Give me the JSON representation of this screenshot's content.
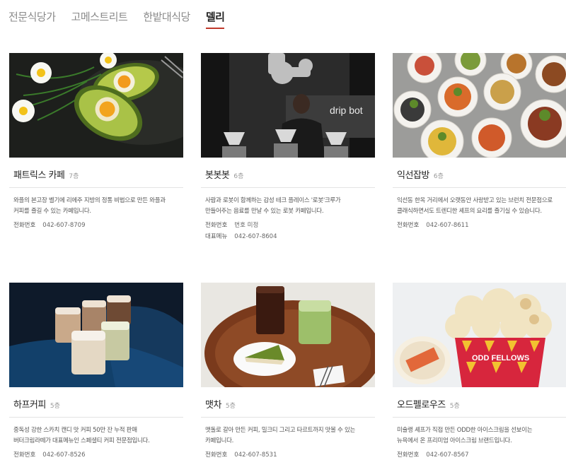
{
  "tabs": [
    {
      "label": "전문식당가"
    },
    {
      "label": "고메스트리트"
    },
    {
      "label": "한밭대식당"
    },
    {
      "label": "델리"
    }
  ],
  "cards": [
    {
      "name": "패트릭스 카페",
      "floor": "7층",
      "desc1": "와플의 본고장 벨기에 리에주 지방의 정통 비법으로 만든 와플과",
      "desc2": "커피를 즐길 수 있는 카페입니다.",
      "phone_label": "전화번호",
      "phone": "042-607-8709"
    },
    {
      "name": "봇봇봇",
      "floor": "6층",
      "desc1": "사람과 로봇이 함께하는 감성 테크 플레이스 '로봇'크루가",
      "desc2": "만들어주는 음료를 만날 수 있는 로봇 카페입니다.",
      "phone_label": "전화번호",
      "phone": "번호 미정",
      "menu_label": "대표메뉴",
      "menu": "042-607-8604",
      "sign_text": "drip bot"
    },
    {
      "name": "익선잡방",
      "floor": "6층",
      "desc1": "익선동 한옥 거리에서 오랫동안 사랑받고 있는 브런치 전문점으로",
      "desc2": "클래식하면서도 트렌디한 셰프의 요리를 즐기실 수 있습니다.",
      "phone_label": "전화번호",
      "phone": "042-607-8611"
    },
    {
      "name": "하프커피",
      "floor": "5층",
      "desc1": "중독성 강한 스카치 캔디 맛 커피 50만 잔 누적 판매",
      "desc2": "버터크림라떼가 대표메뉴인 스페셜티 커피 전문점입니다.",
      "phone_label": "전화번호",
      "phone": "042-607-8526"
    },
    {
      "name": "맷차",
      "floor": "5층",
      "desc1": "맷돌로 갈아 만든 커피, 밀크티 그리고 타르트까지 맛볼 수 있는",
      "desc2": "카페입니다.",
      "phone_label": "전화번호",
      "phone": "042-607-8531"
    },
    {
      "name": "오드펠로우즈",
      "floor": "5층",
      "desc1": "미슐랭 셰프가 직접 만든 ODD한 아이스크림을 선보이는",
      "desc2": "뉴욕에서 온 프리미엄 아이스크림 브랜드입니다.",
      "phone_label": "전화번호",
      "phone": "042-607-8567",
      "brand_text": "ODD FELLOWS"
    }
  ]
}
